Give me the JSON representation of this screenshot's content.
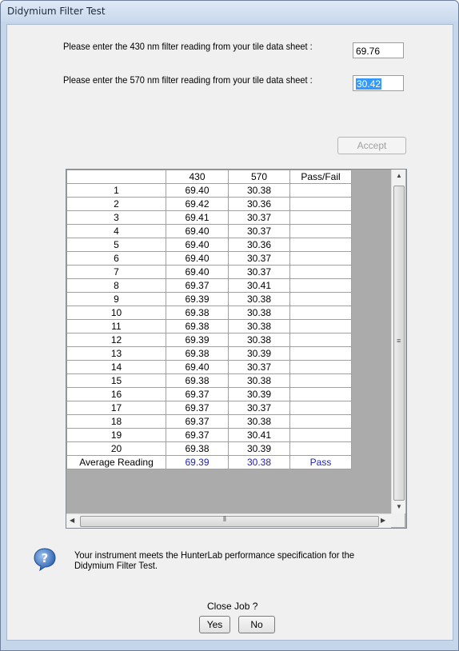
{
  "window": {
    "title": "Didymium Filter Test"
  },
  "form": {
    "prompt_430": "Please enter the 430 nm filter reading from your tile data sheet :",
    "value_430": "69.76",
    "prompt_570": "Please enter the 570 nm filter reading from your tile data sheet :",
    "value_570": "30.42",
    "accept_label": "Accept"
  },
  "grid": {
    "headers": [
      "430",
      "570",
      "Pass/Fail"
    ],
    "rows": [
      {
        "id": "1",
        "v430": "69.40",
        "v570": "30.38"
      },
      {
        "id": "2",
        "v430": "69.42",
        "v570": "30.36"
      },
      {
        "id": "3",
        "v430": "69.41",
        "v570": "30.37"
      },
      {
        "id": "4",
        "v430": "69.40",
        "v570": "30.37"
      },
      {
        "id": "5",
        "v430": "69.40",
        "v570": "30.36"
      },
      {
        "id": "6",
        "v430": "69.40",
        "v570": "30.37"
      },
      {
        "id": "7",
        "v430": "69.40",
        "v570": "30.37"
      },
      {
        "id": "8",
        "v430": "69.37",
        "v570": "30.41"
      },
      {
        "id": "9",
        "v430": "69.39",
        "v570": "30.38"
      },
      {
        "id": "10",
        "v430": "69.38",
        "v570": "30.38"
      },
      {
        "id": "11",
        "v430": "69.38",
        "v570": "30.38"
      },
      {
        "id": "12",
        "v430": "69.39",
        "v570": "30.38"
      },
      {
        "id": "13",
        "v430": "69.38",
        "v570": "30.39"
      },
      {
        "id": "14",
        "v430": "69.40",
        "v570": "30.37"
      },
      {
        "id": "15",
        "v430": "69.38",
        "v570": "30.38"
      },
      {
        "id": "16",
        "v430": "69.37",
        "v570": "30.39"
      },
      {
        "id": "17",
        "v430": "69.37",
        "v570": "30.37"
      },
      {
        "id": "18",
        "v430": "69.37",
        "v570": "30.38"
      },
      {
        "id": "19",
        "v430": "69.37",
        "v570": "30.41"
      },
      {
        "id": "20",
        "v430": "69.38",
        "v570": "30.39"
      }
    ],
    "average": {
      "label": "Average Reading",
      "v430": "69.39",
      "v570": "30.38",
      "result": "Pass"
    }
  },
  "message": {
    "icon": "question-icon",
    "text": "Your instrument meets the HunterLab performance specification for the Didymium Filter Test."
  },
  "close": {
    "question": "Close Job ?",
    "yes_label": "Yes",
    "no_label": "No"
  },
  "colors": {
    "value_blue": "#1f1fb0",
    "selection": "#3399ff"
  }
}
